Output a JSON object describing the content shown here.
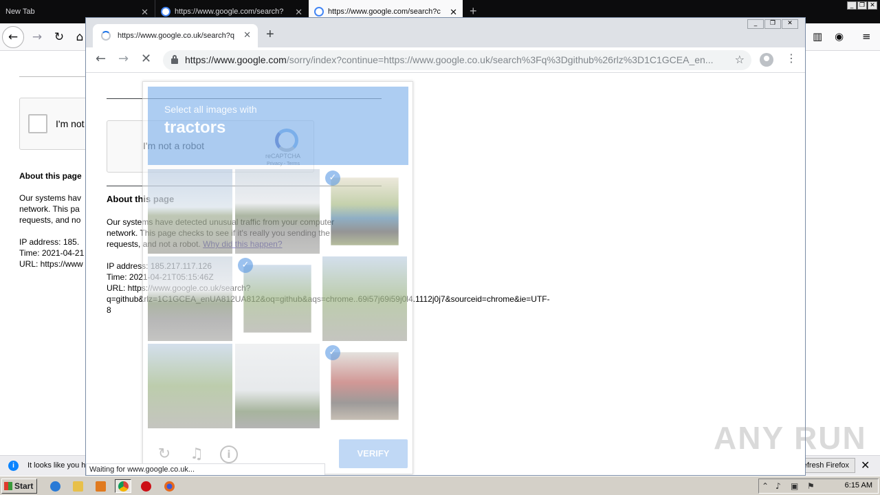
{
  "firefox": {
    "tabs": [
      {
        "label": "New Tab"
      },
      {
        "label": "https://www.google.com/search?"
      },
      {
        "label": "https://www.google.com/search?c"
      }
    ],
    "content": {
      "checkbox_label": "I'm not",
      "about_heading": "About this page",
      "lines": [
        "Our systems hav",
        "network. This pa",
        "requests, and no",
        "IP address: 185.",
        "Time: 2021-04-21",
        "URL: https://www"
      ]
    },
    "notification": {
      "message": "It looks like you h",
      "refresh_label": "Refresh Firefox..."
    }
  },
  "chrome": {
    "tab_title": "https://www.google.co.uk/search?q",
    "url_host": "https://www.google.com",
    "url_path": "/sorry/index?continue=https://www.google.co.uk/search%3Fq%3Dgithub%26rlz%3D1C1GCEA_en...",
    "status_text": "Waiting for www.google.co.uk...",
    "page": {
      "recaptcha_label": "I'm not a robot",
      "recaptcha_brand": "reCAPTCHA",
      "recaptcha_links": "Privacy - Terms",
      "about_heading": "About this page",
      "body_lines": [
        "Our systems have detected unusual traffic from your computer",
        "network. This page checks to see if it's really you sending the"
      ],
      "body_line3": "requests, and not a robot. ",
      "why_link": "Why did this happen?",
      "ip_line": "IP address: 185.217.117.126",
      "time_line": "Time: 2021-04-21T05:15:46Z",
      "url_line1": "URL: https://www.google.co.uk/search?",
      "url_line2": "q=github&rlz=1C1GCEA_enUA812UA812&oq=github&aqs=chrome..69i57j69i59j0l4.1112j0j7&sourceid=chrome&ie=UTF-",
      "url_line3": "8"
    },
    "challenge": {
      "instruction": "Select all images with",
      "target": "tractors",
      "verify_label": "VERIFY",
      "selected_tiles": [
        3,
        5,
        9
      ]
    }
  },
  "watermark": "ANY RUN",
  "taskbar": {
    "start_label": "Start",
    "clock": "6:15 AM"
  }
}
